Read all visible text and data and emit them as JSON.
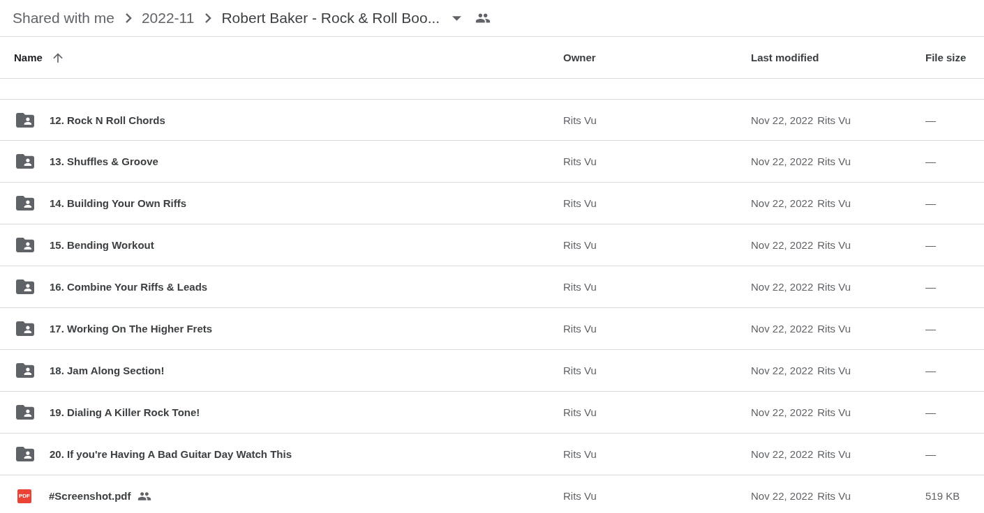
{
  "breadcrumb": [
    {
      "label": "Shared with me"
    },
    {
      "label": "2022-11"
    },
    {
      "label": "Robert Baker - Rock & Roll Boo...",
      "current": true
    }
  ],
  "table": {
    "columns": [
      {
        "label": "Name",
        "sorted": true
      },
      {
        "label": "Owner",
        "sorted": false
      },
      {
        "label": "Last modified",
        "sorted": false
      },
      {
        "label": "File size",
        "sorted": false
      }
    ],
    "rows": [
      {
        "kind": "shared-folder",
        "name": "12. Rock N Roll Chords",
        "owner": "Rits Vu",
        "modified": "Nov 22, 2022",
        "modified_by": "Rits Vu",
        "size": "—"
      },
      {
        "kind": "shared-folder",
        "name": "13. Shuffles & Groove",
        "owner": "Rits Vu",
        "modified": "Nov 22, 2022",
        "modified_by": "Rits Vu",
        "size": "—"
      },
      {
        "kind": "shared-folder",
        "name": "14. Building Your Own Riffs",
        "owner": "Rits Vu",
        "modified": "Nov 22, 2022",
        "modified_by": "Rits Vu",
        "size": "—"
      },
      {
        "kind": "shared-folder",
        "name": "15. Bending Workout",
        "owner": "Rits Vu",
        "modified": "Nov 22, 2022",
        "modified_by": "Rits Vu",
        "size": "—"
      },
      {
        "kind": "shared-folder",
        "name": "16. Combine Your Riffs & Leads",
        "owner": "Rits Vu",
        "modified": "Nov 22, 2022",
        "modified_by": "Rits Vu",
        "size": "—"
      },
      {
        "kind": "shared-folder",
        "name": "17. Working On The Higher Frets",
        "owner": "Rits Vu",
        "modified": "Nov 22, 2022",
        "modified_by": "Rits Vu",
        "size": "—"
      },
      {
        "kind": "shared-folder",
        "name": "18. Jam Along Section!",
        "owner": "Rits Vu",
        "modified": "Nov 22, 2022",
        "modified_by": "Rits Vu",
        "size": "—"
      },
      {
        "kind": "shared-folder",
        "name": "19. Dialing A Killer Rock Tone!",
        "owner": "Rits Vu",
        "modified": "Nov 22, 2022",
        "modified_by": "Rits Vu",
        "size": "—"
      },
      {
        "kind": "shared-folder",
        "name": "20. If you're Having A Bad Guitar Day Watch This",
        "owner": "Rits Vu",
        "modified": "Nov 22, 2022",
        "modified_by": "Rits Vu",
        "size": "—"
      },
      {
        "kind": "pdf",
        "icon_text": "PDF",
        "name": "#Screenshot.pdf",
        "shared": true,
        "owner": "Rits Vu",
        "modified": "Nov 22, 2022",
        "modified_by": "Rits Vu",
        "size": "519 KB"
      }
    ]
  }
}
